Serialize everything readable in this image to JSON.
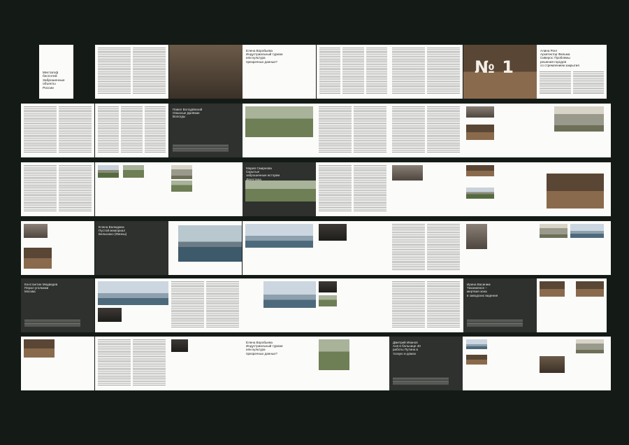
{
  "cover_title": "Мистагоф\nбеспэтей:\nЗаброшенные\nобъекты\nРоссии",
  "spread_titles": {
    "e1": "Елена Воробьева\nИндустриальный туризм\nили культура\nпризрачных данных?",
    "e2": "Алина Ронг\nАрхитектор Фильма\nСиверск: Проблемы\nрешения городов\nсо стремлением закрытия",
    "e3": "Павел Володёвский\nОпасные Далёкие\nВологды",
    "e4": "Мария Смирнова\nСкрытые\nзаброшенные истории\nДагестана",
    "e5": "Елена Валюдина\nПустой мемориал\nБелыхюкэ (Финны)",
    "e6": "Константин Медведев\nПерал уголками\nМосква",
    "e7": "Ирина Васиним\nТиханиенсе –\nмертвая зона\nв заводских видения",
    "e8": "Дмитрий Иванов\nАня в больнице 40\nработы Путина в\nтоскую и домах"
  },
  "sign_text": "№ 1"
}
